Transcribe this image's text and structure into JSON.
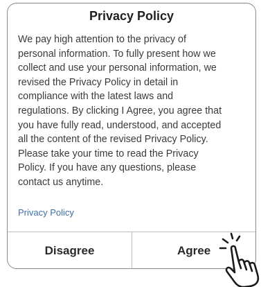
{
  "dialog": {
    "title": "Privacy Policy",
    "body_lines": [
      "We pay high attention to the privacy of",
      "personal information. To fully present how we",
      "collect and use your personal information, we",
      "revised the Privacy Policy in detail in",
      "compliance with the latest laws and",
      "regulations. By clicking I Agree, you agree that",
      "you have fully read, understood, and accepted",
      "all the content of the revised Privacy Policy.",
      "Please take your time to read the Privacy",
      "Policy. If you have any questions, please",
      "contact us anytime."
    ],
    "link_label": "Privacy Policy",
    "disagree_label": "Disagree",
    "agree_label": "Agree"
  },
  "icons": {
    "pointer": "tap-hand-icon"
  },
  "colors": {
    "link": "#3d6fa8",
    "border": "#8a8a8a",
    "divider": "#bdbdbd"
  }
}
